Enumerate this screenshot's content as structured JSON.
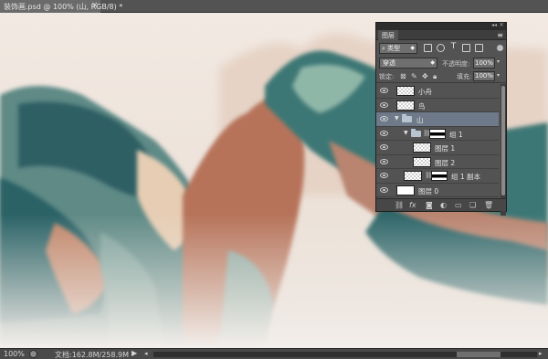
{
  "document": {
    "tab_title": "装饰画.psd @ 100% (山, RGB/8) *",
    "close_glyph": "×"
  },
  "status": {
    "zoom": "100%",
    "doc_size": "文档:162.8M/258.9M",
    "arrow": "▶"
  },
  "layers_panel": {
    "tab": "图层",
    "menu_glyph": "≡",
    "kind": "类型",
    "blend_mode": "穿透",
    "opacity_label": "不透明度:",
    "opacity": "100%",
    "lock_label": "锁定:",
    "fill_label": "填充:",
    "fill": "100%",
    "layers": [
      {
        "name": "小舟",
        "type": "layer",
        "indent": 0,
        "selected": false
      },
      {
        "name": "鸟",
        "type": "layer",
        "indent": 0,
        "selected": false
      },
      {
        "name": "山",
        "type": "group",
        "indent": 0,
        "selected": true,
        "expanded": true
      },
      {
        "name": "组 1",
        "type": "group",
        "indent": 1,
        "selected": false,
        "expanded": true
      },
      {
        "name": "图层 1",
        "type": "layer",
        "indent": 2,
        "selected": false
      },
      {
        "name": "图层 2",
        "type": "layer",
        "indent": 2,
        "selected": false
      },
      {
        "name": "组 1 副本",
        "type": "group",
        "indent": 1,
        "selected": false,
        "expanded": false
      },
      {
        "name": "图层 0",
        "type": "layer",
        "indent": 0,
        "selected": false
      }
    ],
    "footer_icons": [
      "link-icon",
      "fx-icon",
      "mask-icon",
      "adjustment-icon",
      "folder-icon",
      "new-layer-icon",
      "trash-icon"
    ]
  },
  "colors": {
    "selected_row": "#6e7a8a",
    "panel_bg": "#535353",
    "teal": "#2f6a6d",
    "rust": "#b5735a",
    "cream": "#efe3d6"
  }
}
